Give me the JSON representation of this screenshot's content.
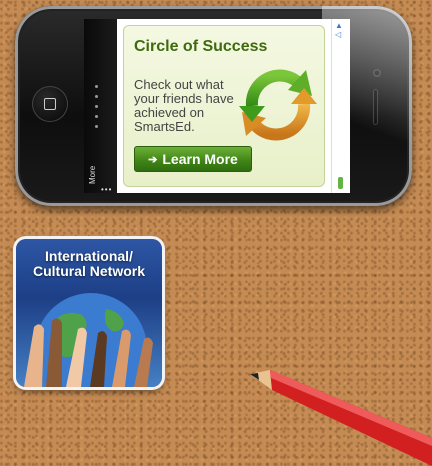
{
  "ad": {
    "title": "Circle of Success",
    "body": "Check out what your friends have achieved on SmartsEd.",
    "cta_label": "Learn More",
    "cta_icon": "arrow-right-icon",
    "graphic_icon": "refresh-cycle-icon",
    "info_icon": "ad-info-icon"
  },
  "app_strip": {
    "more_label": "More",
    "more_dots": "•••"
  },
  "tile": {
    "title_line1": "International/",
    "title_line2": "Cultural Network",
    "image": "hands-around-globe"
  },
  "colors": {
    "cork": "#c48b54",
    "ad_title": "#3f6a0f",
    "cta_green": "#3f8316",
    "tile_blue": "#1d3f86",
    "pencil_red": "#d21f1f"
  }
}
